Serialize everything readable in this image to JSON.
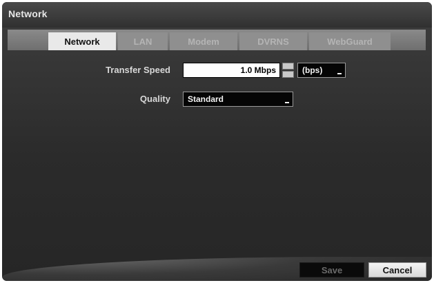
{
  "window": {
    "title": "Network"
  },
  "tabs": [
    {
      "label": "Network",
      "active": true
    },
    {
      "label": "LAN",
      "active": false
    },
    {
      "label": "Modem",
      "active": false
    },
    {
      "label": "DVRNS",
      "active": false
    },
    {
      "label": "WebGuard",
      "active": false
    }
  ],
  "form": {
    "transfer_speed": {
      "label": "Transfer Speed",
      "value": "1.0 Mbps",
      "unit": "(bps)"
    },
    "quality": {
      "label": "Quality",
      "value": "Standard"
    }
  },
  "buttons": {
    "save": "Save",
    "cancel": "Cancel"
  },
  "colors": {
    "active_tab": "#e9e9e9",
    "inactive_tab": "#8f8f8f",
    "panel": "#2b2b2b"
  }
}
